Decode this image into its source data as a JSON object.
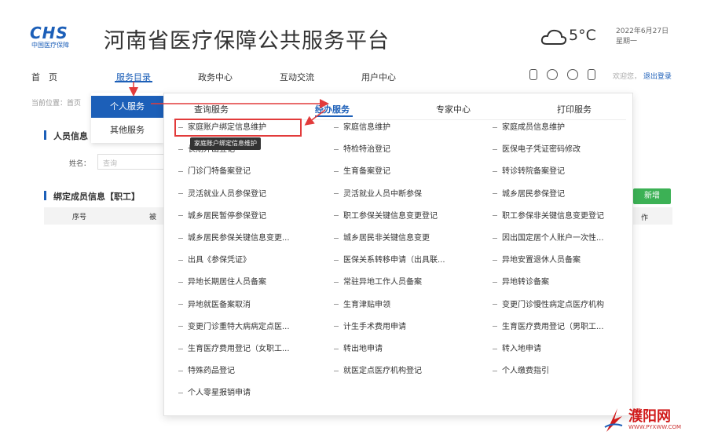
{
  "header": {
    "logo_text": "CHS",
    "logo_sub": "中国医疗保障",
    "site_title": "河南省医疗保障公共服务平台",
    "temperature": "5°C",
    "date": "2022年6月27日",
    "weekday": "星期一"
  },
  "nav": {
    "items": [
      "首　页",
      "服务目录",
      "政务中心",
      "互动交流",
      "用户中心"
    ],
    "active": "服务目录",
    "user": "欢迎您，",
    "logout": "退出登录"
  },
  "breadcrumb": "当前位置：首页",
  "page": {
    "person_info_title": "人员信息",
    "name_label": "姓名：",
    "name_placeholder": "查询",
    "members_title": "绑定成员信息【职工】",
    "col_index": "序号",
    "col_2": "被",
    "col_last": "作",
    "add_button": "新增"
  },
  "submenu": {
    "items": [
      "个人服务",
      "其他服务"
    ],
    "active": "个人服务"
  },
  "dropdown": {
    "tabs": [
      "查询服务",
      "经办服务",
      "专家中心",
      "打印服务"
    ],
    "active_tab": "经办服务",
    "columns": [
      [
        "家庭账户绑定信息维护",
        "长期外出登记",
        "门诊门特备案登记",
        "灵活就业人员参保登记",
        "城乡居民暂停参保登记",
        "城乡居民参保关键信息变更...",
        "出具《参保凭证》",
        "异地长期居住人员备案",
        "异地就医备案取消",
        "变更门诊重特大病病定点医...",
        "生育医疗费用登记（女职工...",
        "特殊药品登记",
        "个人零星报销申请"
      ],
      [
        "家庭信息维护",
        "特检特治登记",
        "生育备案登记",
        "灵活就业人员中断参保",
        "职工参保关键信息变更登记",
        "城乡居民非关键信息变更",
        "医保关系转移申请（出具联...",
        "常驻异地工作人员备案",
        "生育津贴申领",
        "计生手术费用申请",
        "转出地申请",
        "就医定点医疗机构登记"
      ],
      [
        "家庭成员信息维护",
        "医保电子凭证密码修改",
        "转诊转院备案登记",
        "城乡居民参保登记",
        "职工参保非关键信息变更登记",
        "因出国定居个人账户一次性...",
        "异地安置退休人员备案",
        "异地转诊备案",
        "变更门诊慢性病定点医疗机构",
        "生育医疗费用登记（男职工...",
        "转入地申请",
        "个人缴费指引"
      ]
    ],
    "tooltip": "家庭账户绑定信息维护"
  },
  "watermark": {
    "title": "濮阳网",
    "url": "WWW.PYXWW.COM"
  },
  "colors": {
    "primary": "#1c5fb8",
    "highlight": "#e23b3b",
    "add": "#3cb155"
  }
}
